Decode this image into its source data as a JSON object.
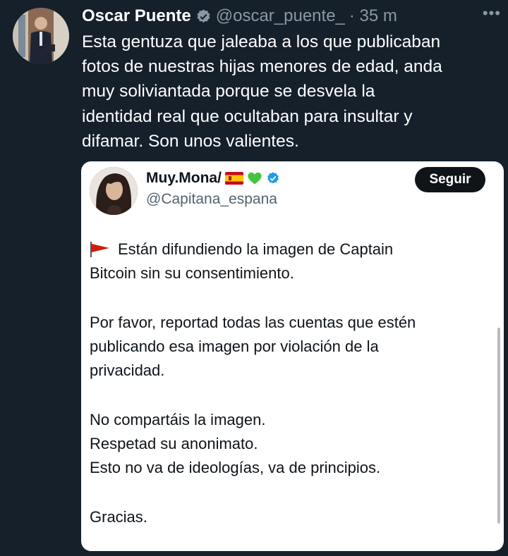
{
  "tweet": {
    "author_name": "Oscar Puente",
    "author_handle": "@oscar_puente_",
    "time": "· 35 m",
    "more_label": "•••",
    "text_lines": [
      "Esta gentuza que jaleaba a los que publicaban",
      "fotos de nuestras hijas menores de edad, anda",
      "muy soliviantada porque se desvela la",
      "identidad real que ocultaban para insultar y",
      "difamar. Son unos valientes."
    ]
  },
  "quote": {
    "author_name": "Muy.Mona/",
    "author_handle": "@Capitana_espana",
    "follow_label": "Seguir",
    "line1": "Están difundiendo la imagen de Captain",
    "line2": "Bitcoin sin su consentimiento.",
    "line3": "Por favor, reportad todas las cuentas que estén",
    "line4": "publicando esa imagen por violación de la",
    "line5": "privacidad.",
    "line6": "No compartáis la imagen.",
    "line7": "Respetad su anonimato.",
    "line8": "Esto no va de ideologías, va de principios.",
    "line9": "Gracias."
  },
  "colors": {
    "background": "#15202b",
    "verified": "#1d9bf0",
    "flag_red": "#cc1e14"
  },
  "icons": [
    "verified-badge-icon",
    "more-options-icon",
    "spain-flag-emoji",
    "green-heart-emoji",
    "red-flag-emoji"
  ]
}
